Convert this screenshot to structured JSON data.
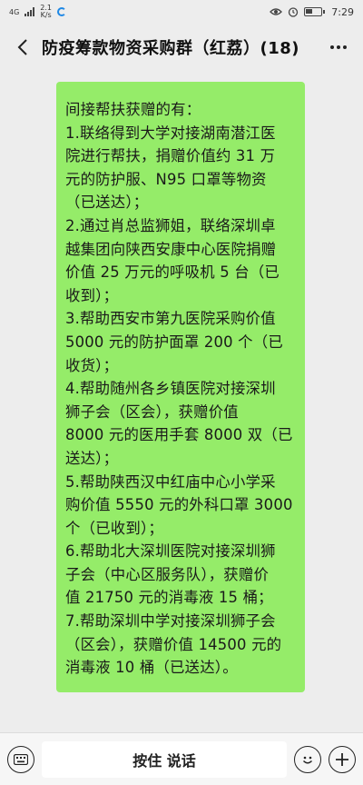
{
  "status_bar": {
    "network": "4G",
    "speed_value": "2.1",
    "speed_unit": "K/s",
    "time": "7:29"
  },
  "header": {
    "title": "防疫筹款物资采购群（红荔）(18)"
  },
  "message": {
    "lines": [
      "间接帮扶获赠的有：",
      "1.联络得到大学对接湖南潜江医",
      "院进行帮扶，捐赠价值约 31 万",
      "元的防护服、N95 口罩等物资",
      "（已送达）；",
      "2.通过肖总监狮姐，联络深圳卓",
      "越集团向陕西安康中心医院捐赠",
      "价值 25 万元的呼吸机 5 台（已",
      "收到）；",
      "3.帮助西安市第九医院采购价值",
      "5000 元的防护面罩 200 个（已",
      "收货）；",
      "4.帮助随州各乡镇医院对接深圳",
      "狮子会（区会），获赠价值",
      "8000 元的医用手套 8000 双（已",
      "送达）；",
      "5.帮助陕西汉中红庙中心小学采",
      "购价值 5550 元的外科口罩 3000",
      "个（已收到）；",
      "6.帮助北大深圳医院对接深圳狮",
      "子会（中心区服务队），获赠价",
      "值 21750 元的消毒液 15 桶；",
      "7.帮助深圳中学对接深圳狮子会",
      "（区会），获赠价值 14500 元的",
      "消毒液 10 桶（已送达）。"
    ]
  },
  "input_bar": {
    "hold_to_talk": "按住 说话"
  },
  "colors": {
    "bubble": "#95ec69",
    "background": "#ededed"
  },
  "icons": {
    "back": "chevron-left-icon",
    "more": "more-dots-icon",
    "keyboard": "keyboard-icon",
    "emoji": "emoji-icon",
    "plus": "plus-icon"
  }
}
